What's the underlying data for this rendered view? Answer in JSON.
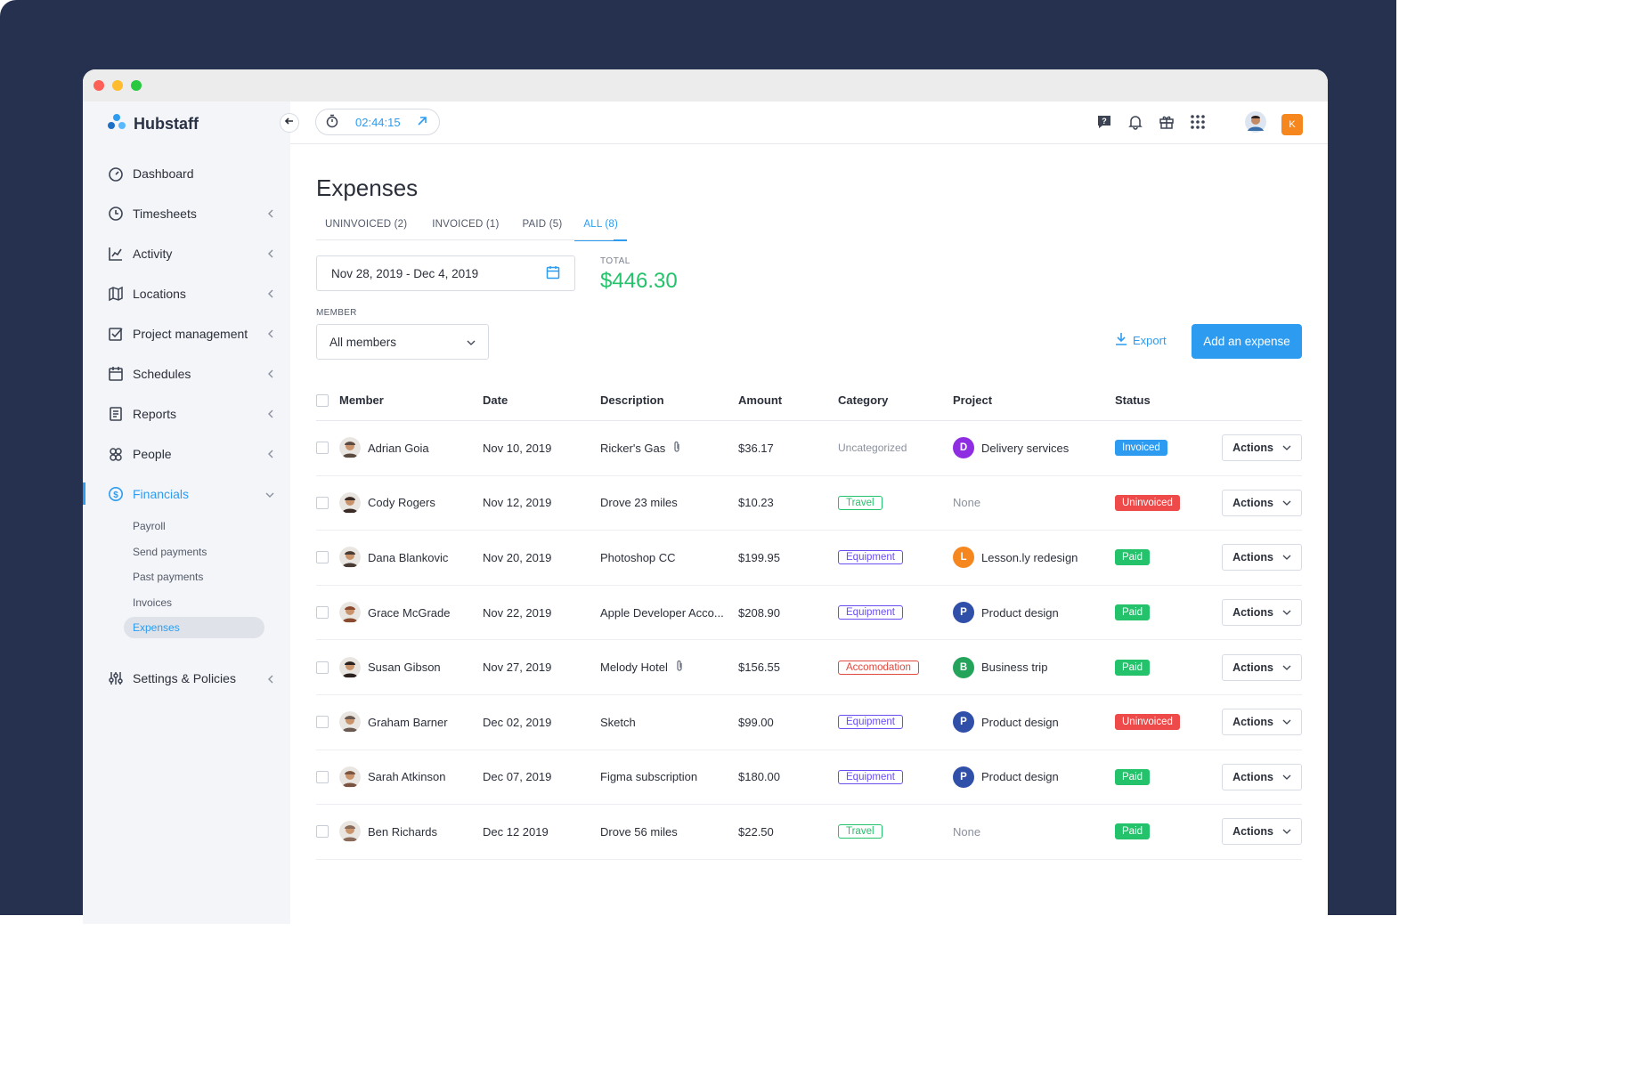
{
  "app": {
    "name": "Hubstaff"
  },
  "colors": {
    "accent": "#2d9cf0",
    "success": "#24c26b",
    "danger": "#ee4a4a",
    "equipment": "#6b4ef0",
    "brand_dark": "#26304f"
  },
  "timer": {
    "value": "02:44:15"
  },
  "sidebar": {
    "items": [
      {
        "label": "Dashboard",
        "icon": "dashboard-icon"
      },
      {
        "label": "Timesheets",
        "icon": "clock-icon"
      },
      {
        "label": "Activity",
        "icon": "chart-icon"
      },
      {
        "label": "Locations",
        "icon": "map-icon"
      },
      {
        "label": "Project management",
        "icon": "checkbox-icon"
      },
      {
        "label": "Schedules",
        "icon": "calendar-icon"
      },
      {
        "label": "Reports",
        "icon": "document-icon"
      },
      {
        "label": "People",
        "icon": "people-icon"
      },
      {
        "label": "Financials",
        "icon": "dollar-icon"
      },
      {
        "label": "Settings & Policies",
        "icon": "sliders-icon"
      }
    ],
    "financials_sub": [
      "Payroll",
      "Send payments",
      "Past payments",
      "Invoices",
      "Expenses"
    ]
  },
  "header": {
    "avatar_initial": "K"
  },
  "page": {
    "title": "Expenses",
    "tabs": [
      "UNINVOICED (2)",
      "INVOICED (1)",
      "PAID (5)",
      "ALL (8)"
    ],
    "date_range": "Nov 28, 2019 - Dec 4, 2019",
    "total_label": "TOTAL",
    "total_value": "$446.30",
    "member_label": "MEMBER",
    "member_value": "All members",
    "export_label": "Export",
    "add_label": "Add an expense"
  },
  "table": {
    "headers": [
      "Member",
      "Date",
      "Description",
      "Amount",
      "Category",
      "Project",
      "Status"
    ],
    "actions_label": "Actions",
    "rows": [
      {
        "member": "Adrian Goia",
        "date": "Nov 10, 2019",
        "description": "Ricker's Gas",
        "attachment": true,
        "amount": "$36.17",
        "category": "Uncategorized",
        "cat_type": "uncat",
        "project": "Delivery services",
        "project_initial": "D",
        "project_color": "#8e2de2",
        "status": "Invoiced",
        "status_type": "invoiced",
        "avatar_color": "#5b4a3f"
      },
      {
        "member": "Cody Rogers",
        "date": "Nov 12, 2019",
        "description": "Drove 23 miles",
        "attachment": false,
        "amount": "$10.23",
        "category": "Travel",
        "cat_type": "travel",
        "project": "None",
        "project_initial": "",
        "project_color": "",
        "status": "Uninvoiced",
        "status_type": "uninvoiced",
        "avatar_color": "#3a2b26"
      },
      {
        "member": "Dana Blankovic",
        "date": "Nov 20, 2019",
        "description": "Photoshop CC",
        "attachment": false,
        "amount": "$199.95",
        "category": "Equipment",
        "cat_type": "equip",
        "project": "Lesson.ly redesign",
        "project_initial": "L",
        "project_color": "#f6871f",
        "status": "Paid",
        "status_type": "paid",
        "avatar_color": "#4a3a34"
      },
      {
        "member": "Grace McGrade",
        "date": "Nov 22, 2019",
        "description": "Apple Developer Acco...",
        "attachment": false,
        "amount": "$208.90",
        "category": "Equipment",
        "cat_type": "equip",
        "project": "Product design",
        "project_initial": "P",
        "project_color": "#2f4fa8",
        "status": "Paid",
        "status_type": "paid",
        "avatar_color": "#8a4a2e"
      },
      {
        "member": "Susan Gibson",
        "date": "Nov 27, 2019",
        "description": "Melody Hotel",
        "attachment": true,
        "amount": "$156.55",
        "category": "Accomodation",
        "cat_type": "acc",
        "project": "Business trip",
        "project_initial": "B",
        "project_color": "#24a35a",
        "status": "Paid",
        "status_type": "paid",
        "avatar_color": "#2b221f"
      },
      {
        "member": "Graham Barner",
        "date": "Dec 02, 2019",
        "description": "Sketch",
        "attachment": false,
        "amount": "$99.00",
        "category": "Equipment",
        "cat_type": "equip",
        "project": "Product design",
        "project_initial": "P",
        "project_color": "#2f4fa8",
        "status": "Uninvoiced",
        "status_type": "uninvoiced",
        "avatar_color": "#6a5a52"
      },
      {
        "member": "Sarah Atkinson",
        "date": "Dec 07, 2019",
        "description": "Figma subscription",
        "attachment": false,
        "amount": "$180.00",
        "category": "Equipment",
        "cat_type": "equip",
        "project": "Product design",
        "project_initial": "P",
        "project_color": "#2f4fa8",
        "status": "Paid",
        "status_type": "paid",
        "avatar_color": "#7a5440"
      },
      {
        "member": "Ben Richards",
        "date": "Dec 12 2019",
        "description": "Drove 56 miles",
        "attachment": false,
        "amount": "$22.50",
        "category": "Travel",
        "cat_type": "travel",
        "project": "None",
        "project_initial": "",
        "project_color": "",
        "status": "Paid",
        "status_type": "paid",
        "avatar_color": "#8a6a58"
      }
    ]
  }
}
